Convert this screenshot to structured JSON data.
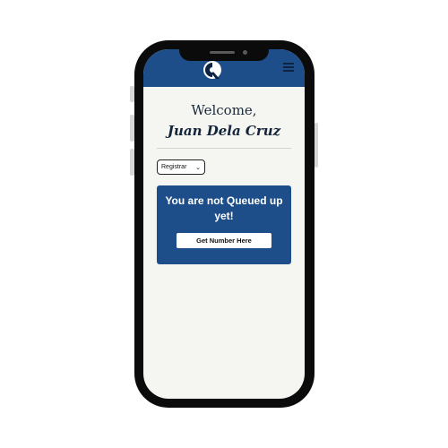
{
  "header": {
    "logo_icon": "q-logo-icon",
    "menu_icon": "hamburger-menu-icon",
    "color": "#1d4e89"
  },
  "welcome": {
    "greeting": "Welcome,",
    "name": "Juan Dela Cruz"
  },
  "office_select": {
    "value": "Registrar"
  },
  "queue_card": {
    "message": "You are not Queued up yet!",
    "button_label": "Get Number Here",
    "color": "#1d4e89"
  }
}
